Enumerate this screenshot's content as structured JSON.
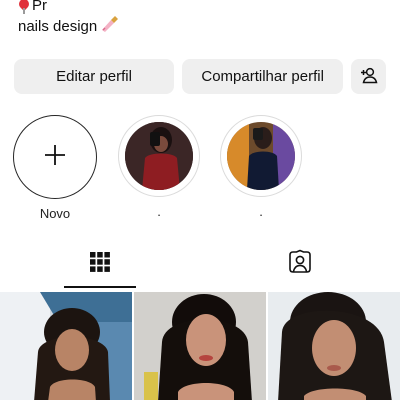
{
  "profile": {
    "location_text": "Pr",
    "bio_line": "nails design"
  },
  "actions": {
    "edit_label": "Editar perfil",
    "share_label": "Compartilhar perfil",
    "add_person_icon": "add-person-icon"
  },
  "highlights": [
    {
      "label": "Novo",
      "icon": "plus-icon"
    },
    {
      "label": "."
    },
    {
      "label": "."
    }
  ],
  "tabs": [
    {
      "icon": "grid-icon",
      "selected": true
    },
    {
      "icon": "tagged-person-icon",
      "selected": false
    }
  ],
  "colors": {
    "button_bg": "#efefef",
    "text": "#111111",
    "border": "#dbdbdb"
  }
}
